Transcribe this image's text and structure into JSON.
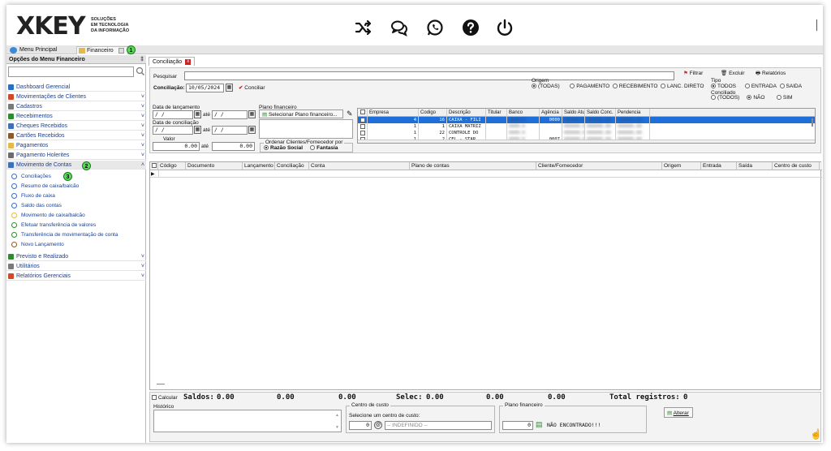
{
  "logo": {
    "text": "XKEY",
    "sub1": "SOLUÇÕES",
    "sub2": "EM TECNOLOGIA",
    "sub3": "DA INFORMAÇÃO"
  },
  "header_icons": [
    "shuffle-icon",
    "chat-icon",
    "whatsapp-icon",
    "help-icon",
    "power-icon"
  ],
  "tabs": {
    "main_menu": "Menu Principal",
    "financeiro": "Financeiro",
    "badge1": "1"
  },
  "left_panel": {
    "title": "Opções do Menu Financeiro",
    "pin": "‡",
    "menu": [
      {
        "label": "Dashboard Gerencial",
        "chevron": ""
      },
      {
        "label": "Movimentações de Clientes",
        "chevron": "˅"
      },
      {
        "label": "Cadastros",
        "chevron": "˅"
      },
      {
        "label": "Recebimentos",
        "chevron": "˅"
      },
      {
        "label": "Cheques Recebidos",
        "chevron": "˅"
      },
      {
        "label": "Cartões Recebidos",
        "chevron": "˅"
      },
      {
        "label": "Pagamentos",
        "chevron": "˅"
      },
      {
        "label": "Pagamento Holerites",
        "chevron": "˅"
      },
      {
        "label": "Movimento de Contas",
        "chevron": "˄"
      }
    ],
    "badge2": "2",
    "badge3": "3",
    "submenu": [
      "Conciliações",
      "Resumo de caixa/balcão",
      "Fluxo de caixa",
      "Saldo das contas",
      "Movimento de caixa/balcão",
      "Efetuar transferência de valores",
      "Transferência de movimentação de conta",
      "Novo Lançamento"
    ],
    "menu_bottom": [
      {
        "label": "Previsto e Realizado",
        "chevron": "˅"
      },
      {
        "label": "Utilitários",
        "chevron": "˅"
      },
      {
        "label": "Relatórios Gerenciais",
        "chevron": "˅"
      }
    ]
  },
  "doc_tab": "Conciliação",
  "form": {
    "search_label": "Pesquisar",
    "conciliacao_label": "Conciliação:",
    "conciliacao_date": "10/05/2024",
    "conciliar_btn": "Conciliar",
    "filter_btn": "Filtrar",
    "delete_btn": "Excluir",
    "reports_btn": "Relatórios",
    "origem_title": "Origem",
    "origem_options": [
      "(TODAS)",
      "PAGAMENTO",
      "RECEBIMENTO",
      "LANC. DIRETO"
    ],
    "tipo_title": "Tipo",
    "tipo_options": [
      "TODOS",
      "ENTRADA",
      "SAIDA"
    ],
    "conciliado_title": "Conciliado",
    "conciliado_options": [
      "(TODOS)",
      "NÃO",
      "SIM"
    ],
    "data_lanc_label": "Data de lançamento",
    "data_conc_label": "Data de conciliação",
    "date_empty": " /  /",
    "ate": "até",
    "valor_label": "Valor",
    "valor_from": "0.00",
    "valor_to": "0.00",
    "plano_label": "Plano financeiro",
    "plano_btn": "Selecionar Plano financeiro...",
    "ordenar_title": "Ordenar Clientes/Fornecedor por",
    "ordenar_options": [
      "Razão Social",
      "Fantasia"
    ]
  },
  "accounts_table": {
    "columns": [
      "Empresa",
      "Codigo",
      "Descrição",
      "Titular",
      "Banco",
      "Agência",
      "Saldo Atual",
      "Saldo Conc.",
      "Pendencia"
    ],
    "rows": [
      {
        "empresa": "4",
        "codigo": "16",
        "descricao": "CAIXA - FILI",
        "agencia": "0000"
      },
      {
        "empresa": "1",
        "codigo": "1",
        "descricao": "CAIXA MATRIZ",
        "agencia": ""
      },
      {
        "empresa": "1",
        "codigo": "22",
        "descricao": "CONTROLE DO",
        "agencia": ""
      },
      {
        "empresa": "1",
        "codigo": "2",
        "descricao": "CEL - STAR",
        "agencia": "0007"
      }
    ]
  },
  "grid": {
    "columns": [
      "Código",
      "Documento",
      "Lançamento",
      "Conciliação",
      "Conta",
      "Plano de contas",
      "Cliente/Fornecedor",
      "Origem",
      "Entrada",
      "Saída",
      "Centro de custo"
    ]
  },
  "footer": {
    "calcular": "Calcular",
    "saldos_label": "Saldos:",
    "saldo1": "0.00",
    "saldo2": "0.00",
    "saldo3": "0.00",
    "selec_label": "Selec:",
    "selec1": "0.00",
    "selec2": "0.00",
    "total_label": "Total registros:",
    "total_value": "0",
    "historico": "Histórico",
    "centro_title": "Centro de custo",
    "centro_hint": "Selecione um centro de custo:",
    "centro_code": "0",
    "centro_value": "-- INDEFINIDO --",
    "plano_title": "Plano financeiro",
    "plano_code": "0",
    "plano_value": "NÃO ENCONTRADO!!!",
    "alterar_btn": "Alterar"
  },
  "colors": {
    "accent_blue": "#1a3f8f",
    "badge_green": "#5dd85d",
    "close_red": "#d32020",
    "selected_row": "#1e6fd9"
  }
}
